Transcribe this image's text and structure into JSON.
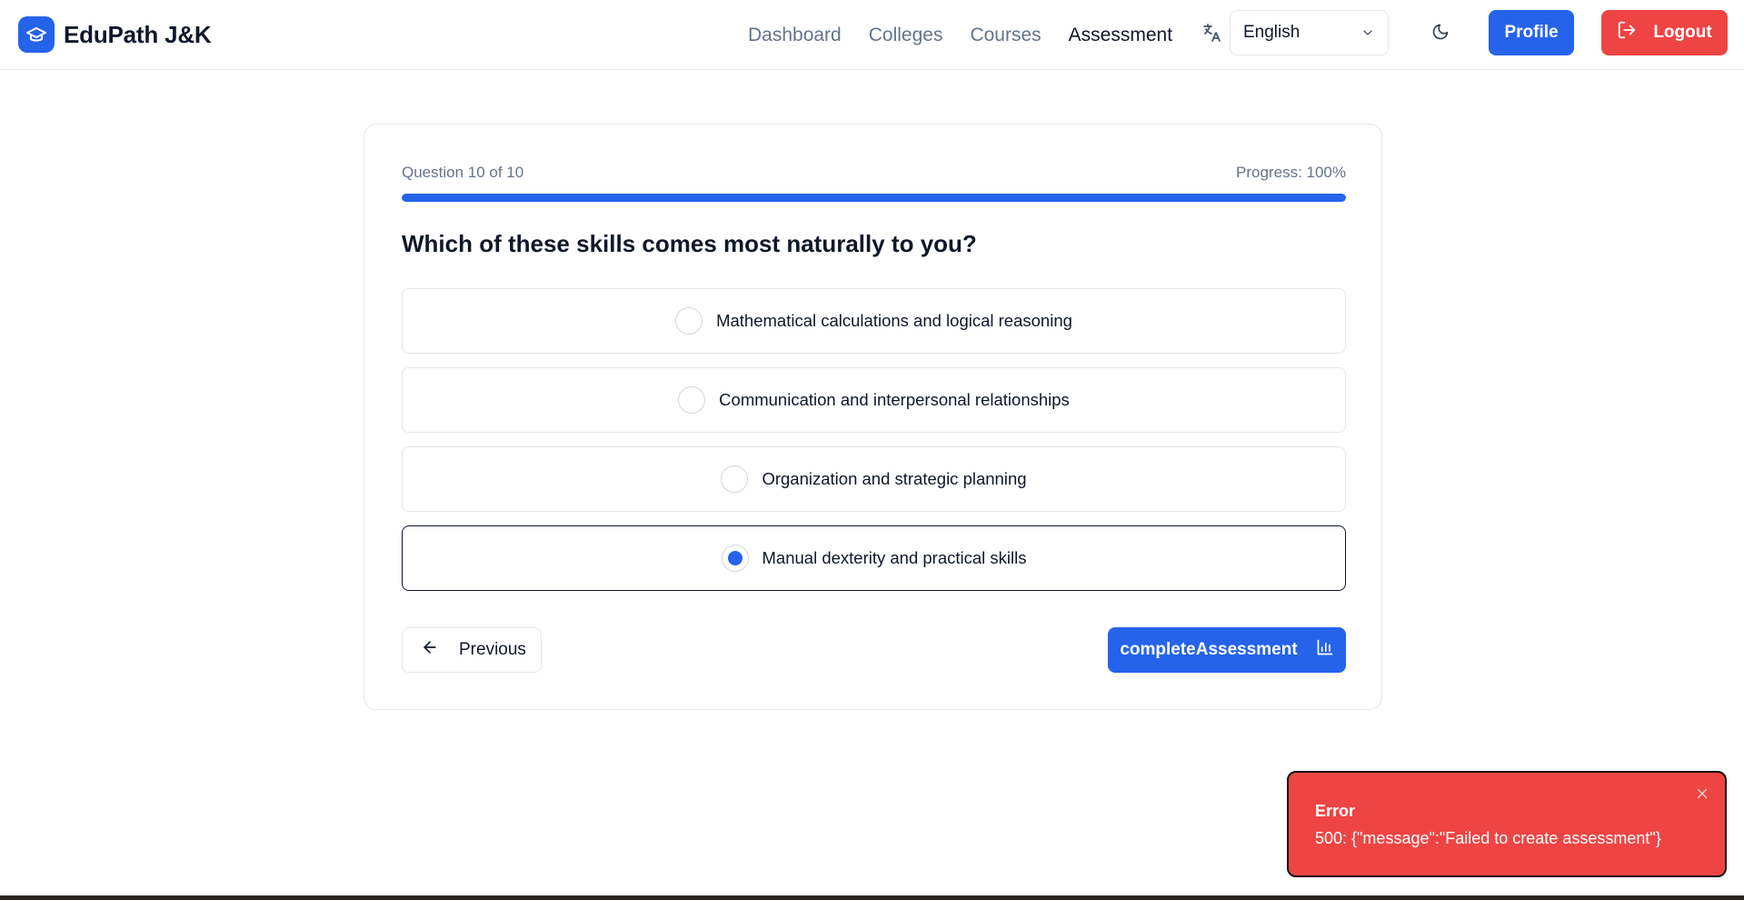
{
  "brand": {
    "name": "EduPath J&K"
  },
  "nav": {
    "items": [
      {
        "label": "Dashboard",
        "active": false
      },
      {
        "label": "Colleges",
        "active": false
      },
      {
        "label": "Courses",
        "active": false
      },
      {
        "label": "Assessment",
        "active": true
      }
    ]
  },
  "language": {
    "selected": "English"
  },
  "header_actions": {
    "profile_label": "Profile",
    "logout_label": "Logout"
  },
  "assessment": {
    "question_counter": "Question 10 of 10",
    "progress_label": "Progress: 100%",
    "progress_value": 1.0,
    "question": "Which of these skills comes most naturally to you?",
    "options": [
      {
        "label": "Mathematical calculations and logical reasoning",
        "selected": false
      },
      {
        "label": "Communication and interpersonal relationships",
        "selected": false
      },
      {
        "label": "Organization and strategic planning",
        "selected": false
      },
      {
        "label": "Manual dexterity and practical skills",
        "selected": true
      }
    ],
    "previous_label": "Previous",
    "complete_label": "completeAssessment"
  },
  "toast": {
    "title": "Error",
    "message": "500: {\"message\":\"Failed to create assessment\"}"
  },
  "colors": {
    "primary": "#2563eb",
    "danger": "#ef4444",
    "text": "#0f172a",
    "muted": "#64748b",
    "border": "#e5e7eb"
  },
  "icons": {
    "brand": "graduation-cap-icon",
    "translate": "translate-icon",
    "theme": "moon-icon",
    "logout": "logout-icon",
    "previous": "arrow-left-icon",
    "complete": "bar-chart-icon",
    "close": "close-icon"
  }
}
